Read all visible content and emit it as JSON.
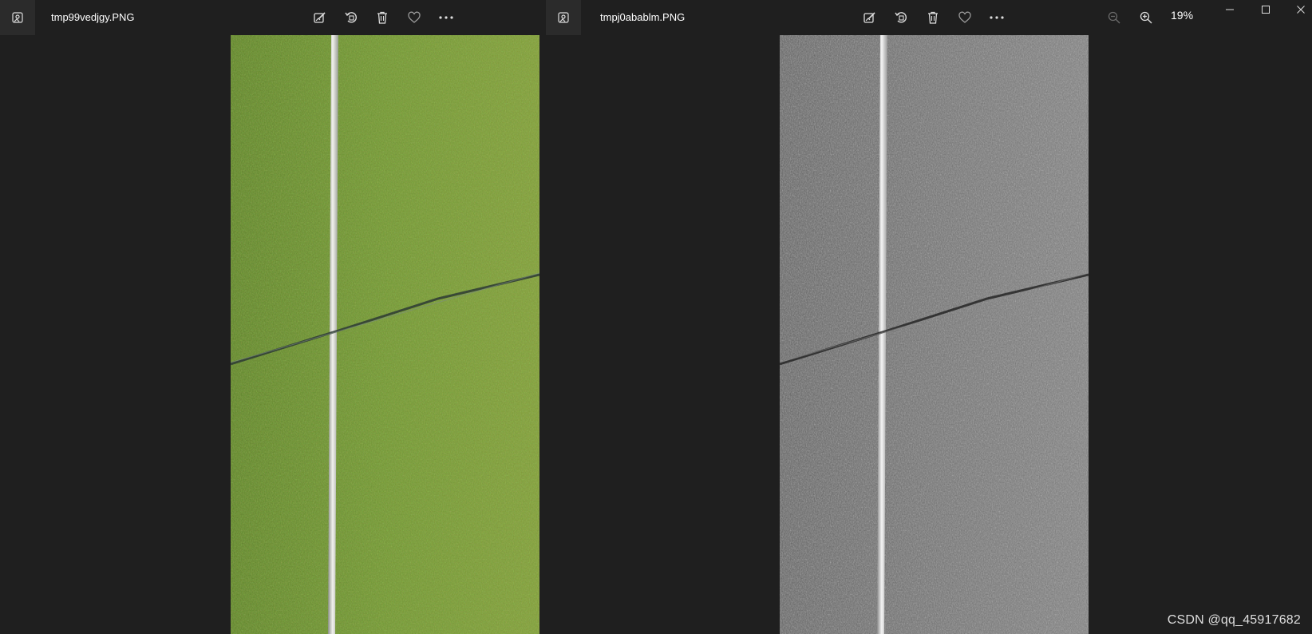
{
  "left_window": {
    "filename": "tmp99vedjgy.PNG",
    "icons": [
      "photos-app-icon",
      "edit-icon",
      "rotate-icon",
      "delete-icon",
      "favorite-icon",
      "more-icon"
    ]
  },
  "right_window": {
    "filename": "tmpj0abablm.PNG",
    "icons": [
      "photos-app-icon",
      "edit-icon",
      "rotate-icon",
      "delete-icon",
      "favorite-icon",
      "more-icon",
      "zoom-out-icon",
      "zoom-in-icon",
      "minimize-icon",
      "maximize-icon",
      "close-icon"
    ],
    "zoom_level": "19%"
  },
  "watermark": "CSDN @qq_45917682",
  "colors": {
    "background": "#1f1f1f",
    "titlebar_icon_bg": "#2b2b2b",
    "grass_color": "#6e8f2f",
    "grayscale_base": "#7a7a7a"
  }
}
